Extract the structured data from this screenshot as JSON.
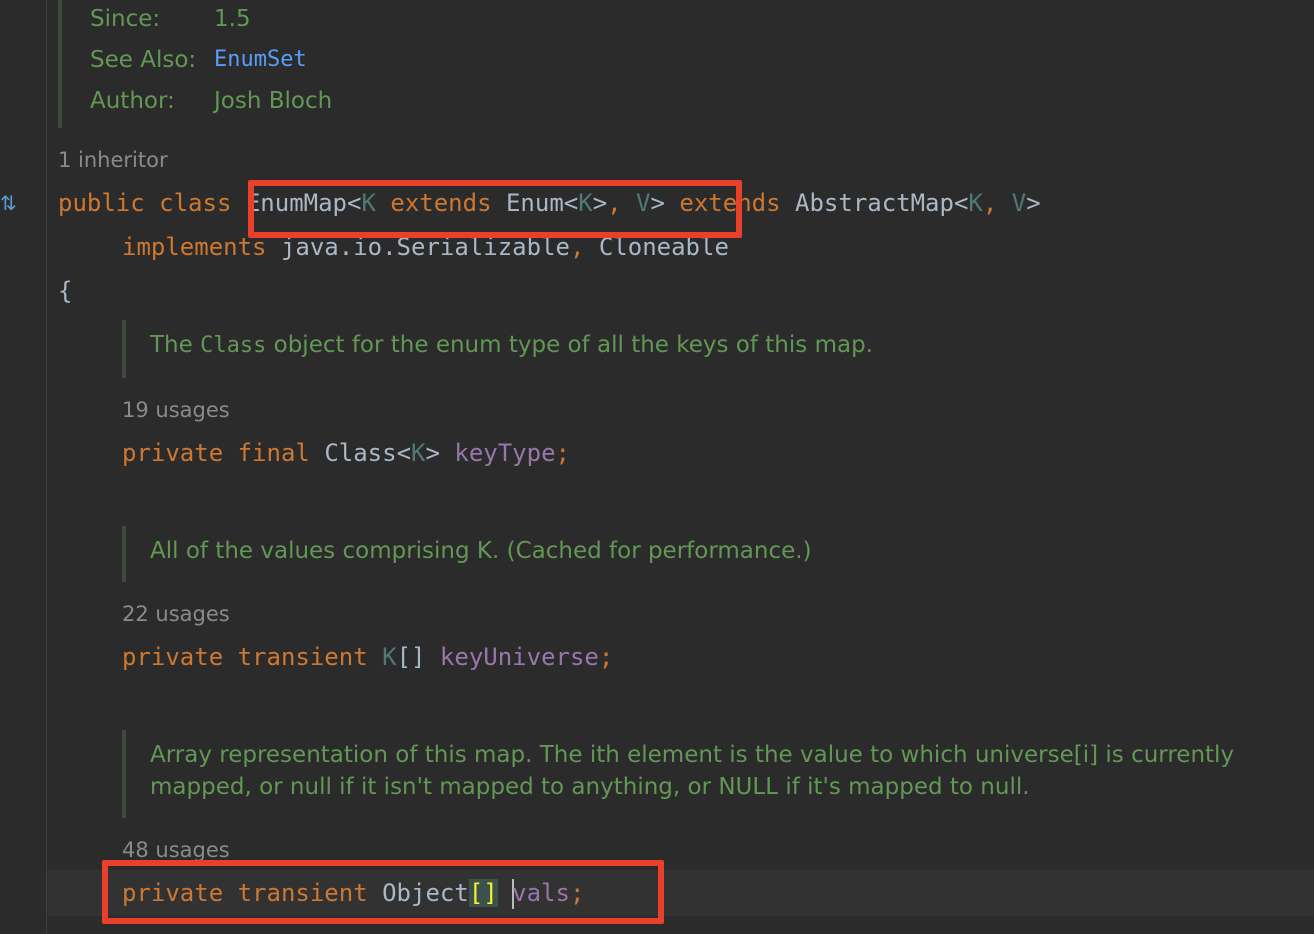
{
  "javadoc_header": {
    "since_label": "Since:",
    "since_value": "1.5",
    "see_also_label": "See Also:",
    "see_also_value": "EnumSet",
    "author_label": "Author:",
    "author_value": "Josh Bloch"
  },
  "inheritor_hint": "1 inheritor",
  "class_decl": {
    "kw_public": "public",
    "kw_class": "class",
    "name": "EnumMap",
    "lt1": "<",
    "type_param_k": "K",
    "kw_extends1": "extends",
    "enum_type": "Enum",
    "lt2": "<",
    "type_param_k2": "K",
    "gt2": ">",
    "comma1": ",",
    "type_param_v": "V",
    "gt1": ">",
    "kw_extends2": "extends",
    "super_type": "AbstractMap",
    "lt3": "<",
    "type_param_k3": "K",
    "comma2": ",",
    "type_param_v2": "V",
    "gt3": ">",
    "kw_implements": "implements",
    "iface1": "java.io.Serializable",
    "comma3": ",",
    "iface2": "Cloneable",
    "open_brace": "{"
  },
  "fields": [
    {
      "doc_prefix": "The ",
      "doc_code": "Class",
      "doc_suffix": " object for the enum type of all the keys of this map.",
      "usages": "19 usages",
      "mod1": "private",
      "mod2": "final",
      "type": "Class",
      "lt": "<",
      "type_param": "K",
      "gt": ">",
      "name": "keyType",
      "semi": ";"
    },
    {
      "doc_text": "All of the values comprising K. (Cached for performance.)",
      "usages": "22 usages",
      "mod1": "private",
      "mod2": "transient",
      "type_param": "K",
      "array": "[]",
      "name": "keyUniverse",
      "semi": ";"
    },
    {
      "doc_line1": "Array representation of this map. The ith element is the value to which universe[i] is currently",
      "doc_line2": "mapped, or null if it isn't mapped to anything, or NULL if it's mapped to null.",
      "usages": "48 usages",
      "mod1": "private",
      "mod2": "transient",
      "type": "Object",
      "array": "[]",
      "name": "vals",
      "semi": ";"
    }
  ],
  "colors": {
    "background": "#2b2b2b",
    "keyword": "#cc7832",
    "doc_comment": "#629755",
    "field": "#9876aa",
    "type_param": "#507874",
    "link": "#589df6",
    "highlight_box": "#e8402a"
  },
  "icons": {
    "gutter": "implementation-marker-icon"
  }
}
